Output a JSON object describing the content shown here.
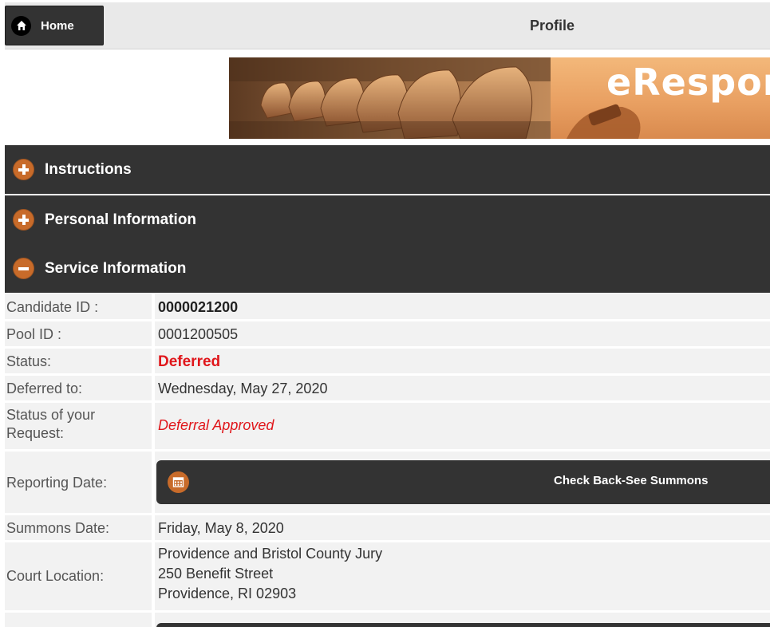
{
  "header": {
    "home_label": "Home",
    "title": "Profile"
  },
  "banner": {
    "text": "eRespor"
  },
  "accordion": {
    "instructions": "Instructions",
    "personal": "Personal Information",
    "service": "Service Information"
  },
  "service": {
    "candidate_id_label": "Candidate ID :",
    "candidate_id": "0000021200",
    "pool_id_label": "Pool ID :",
    "pool_id": "0001200505",
    "status_label": "Status:",
    "status": "Deferred",
    "deferred_to_label": "Deferred to:",
    "deferred_to": "Wednesday, May 27, 2020",
    "request_status_label_1": "Status of your",
    "request_status_label_2": "Request:",
    "request_status": "Deferral Approved",
    "reporting_date_label": "Reporting Date:",
    "reporting_button": "Check Back-See Summons",
    "summons_date_label": "Summons Date:",
    "summons_date": "Friday, May 8, 2020",
    "court_location_label": "Court Location:",
    "court_line1": "Providence and Bristol County Jury",
    "court_line2": "250 Benefit Street",
    "court_line3": "Providence, RI 02903"
  },
  "colors": {
    "bar": "#333333",
    "accent": "#c86b2a",
    "alert_red": "#e0161b",
    "row_bg": "#f2f2f2"
  },
  "icons": {
    "home": "home-icon",
    "expand": "plus-circle-icon",
    "collapse": "minus-circle-icon",
    "calendar": "calendar-icon"
  }
}
